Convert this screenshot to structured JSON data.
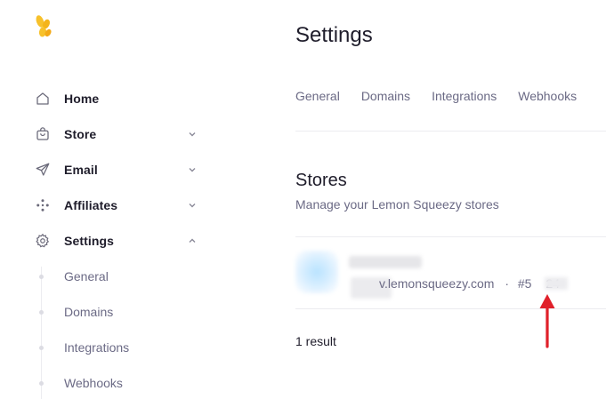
{
  "sidebar": {
    "items": [
      {
        "label": "Home",
        "icon": "home-icon"
      },
      {
        "label": "Store",
        "icon": "bag-icon",
        "chevron": "chevron-down-icon"
      },
      {
        "label": "Email",
        "icon": "send-icon",
        "chevron": "chevron-down-icon"
      },
      {
        "label": "Affiliates",
        "icon": "dots-icon",
        "chevron": "chevron-down-icon"
      },
      {
        "label": "Settings",
        "icon": "gear-icon",
        "chevron": "chevron-up-icon"
      }
    ],
    "settings_subitems": [
      {
        "label": "General"
      },
      {
        "label": "Domains"
      },
      {
        "label": "Integrations"
      },
      {
        "label": "Webhooks"
      }
    ]
  },
  "main": {
    "title": "Settings",
    "tabs": [
      {
        "label": "General"
      },
      {
        "label": "Domains"
      },
      {
        "label": "Integrations"
      },
      {
        "label": "Webhooks"
      }
    ],
    "stores": {
      "title": "Stores",
      "subtitle": "Manage your Lemon Squeezy stores",
      "store": {
        "url_text": "v.lemonsqueezy.com",
        "separator": "·",
        "id_text": "#5",
        "id_suffix": "24"
      },
      "result_count": "1 result"
    }
  },
  "colors": {
    "brand_yellow": "#f7c12b",
    "arrow_red": "#e0202a",
    "muted_text": "#6b6a85",
    "primary_text": "#1f1d2b"
  }
}
